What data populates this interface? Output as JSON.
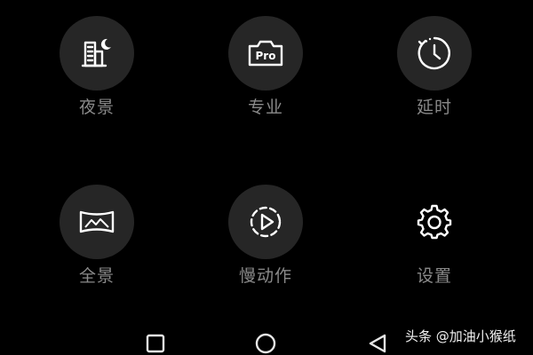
{
  "modes": [
    {
      "id": "night",
      "label": "夜景",
      "icon": "night-building-moon-icon"
    },
    {
      "id": "pro",
      "label": "专业",
      "icon": "pro-camera-icon",
      "icon_text": "Pro"
    },
    {
      "id": "timer",
      "label": "延时",
      "icon": "timelapse-clock-icon"
    },
    {
      "id": "panorama",
      "label": "全景",
      "icon": "panorama-icon"
    },
    {
      "id": "slowmo",
      "label": "慢动作",
      "icon": "slow-motion-play-icon"
    },
    {
      "id": "settings",
      "label": "设置",
      "icon": "gear-icon"
    }
  ],
  "navigation": {
    "recent": "recent-apps-square-icon",
    "home": "home-circle-icon",
    "back": "back-triangle-icon"
  },
  "watermark": "头条 @加油小猴纸",
  "colors": {
    "background": "#000000",
    "circle": "#262626",
    "icon": "#ffffff",
    "label": "#8a8a8a"
  }
}
